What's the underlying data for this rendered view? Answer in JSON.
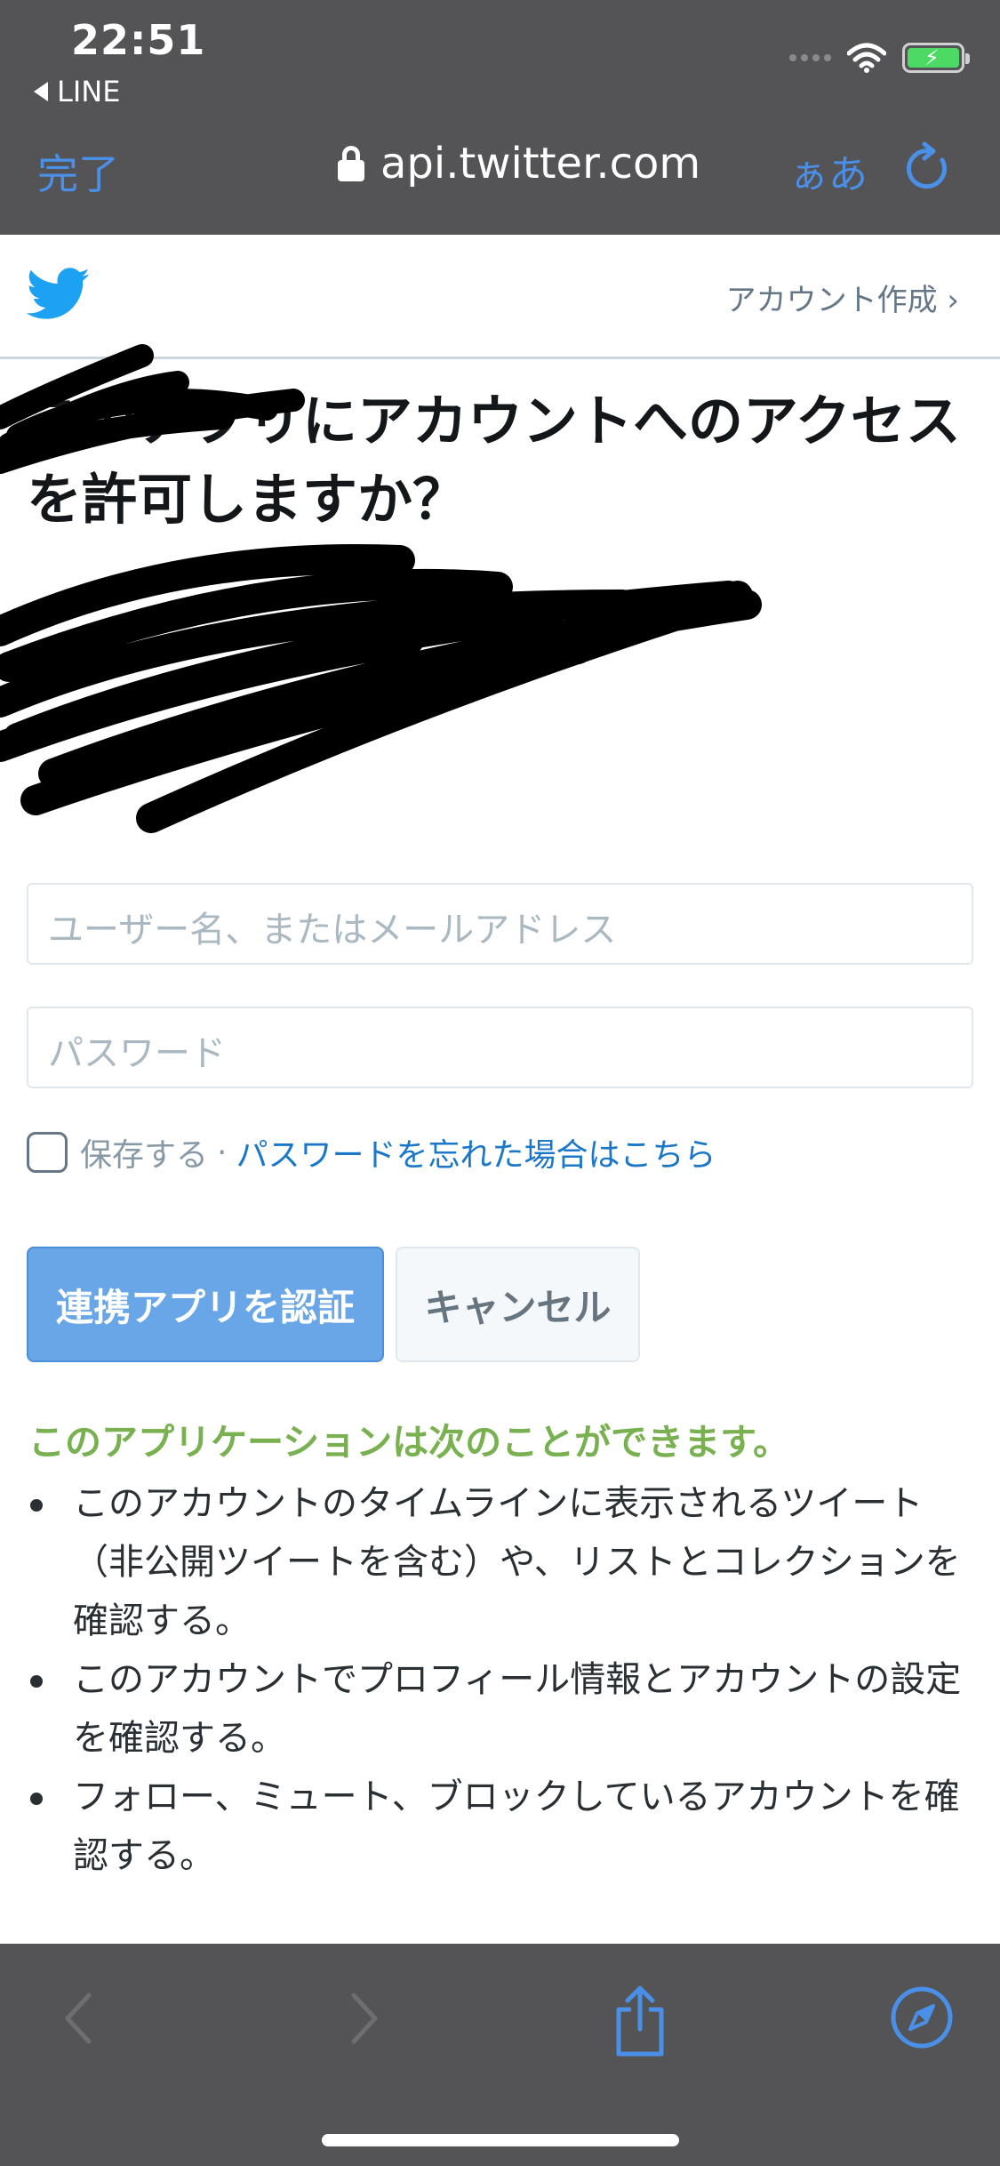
{
  "status_bar": {
    "time": "22:51",
    "back_app": "LINE"
  },
  "browser": {
    "done_label": "完了",
    "url": "api.twitter.com",
    "text_size_label": "ぁあ"
  },
  "twitter": {
    "create_account": "アカウント作成 ›",
    "title": "このアプリにアカウントへのアクセスを許可しますか？",
    "username_placeholder": "ユーザー名、またはメールアドレス",
    "password_placeholder": "パスワード",
    "remember_label": "保存する",
    "separator": "·",
    "forgot_password": "パスワードを忘れた場合はこちら",
    "authorize_button": "連携アプリを認証",
    "cancel_button": "キャンセル",
    "permissions_heading": "このアプリケーションは次のことができます。",
    "permissions": [
      "このアカウントのタイムラインに表示されるツイート（非公開ツイートを含む）や、リストとコレクションを確認する。",
      "このアカウントでプロフィール情報とアカウントの設定を確認する。",
      "フォロー、ミュート、ブロックしているアカウントを確認する。"
    ]
  },
  "colors": {
    "chrome_bg": "#545456",
    "ios_blue": "#4a8fe8",
    "twitter_blue": "#1da1f2",
    "authorize_bg": "#69a6e8",
    "permission_heading": "#79b150"
  },
  "icons": {
    "lock": "lock-icon",
    "reload": "reload-icon",
    "bird": "twitter-bird-icon",
    "back": "chevron-left-icon",
    "forward": "chevron-right-icon",
    "share": "share-icon",
    "compass": "compass-icon"
  }
}
